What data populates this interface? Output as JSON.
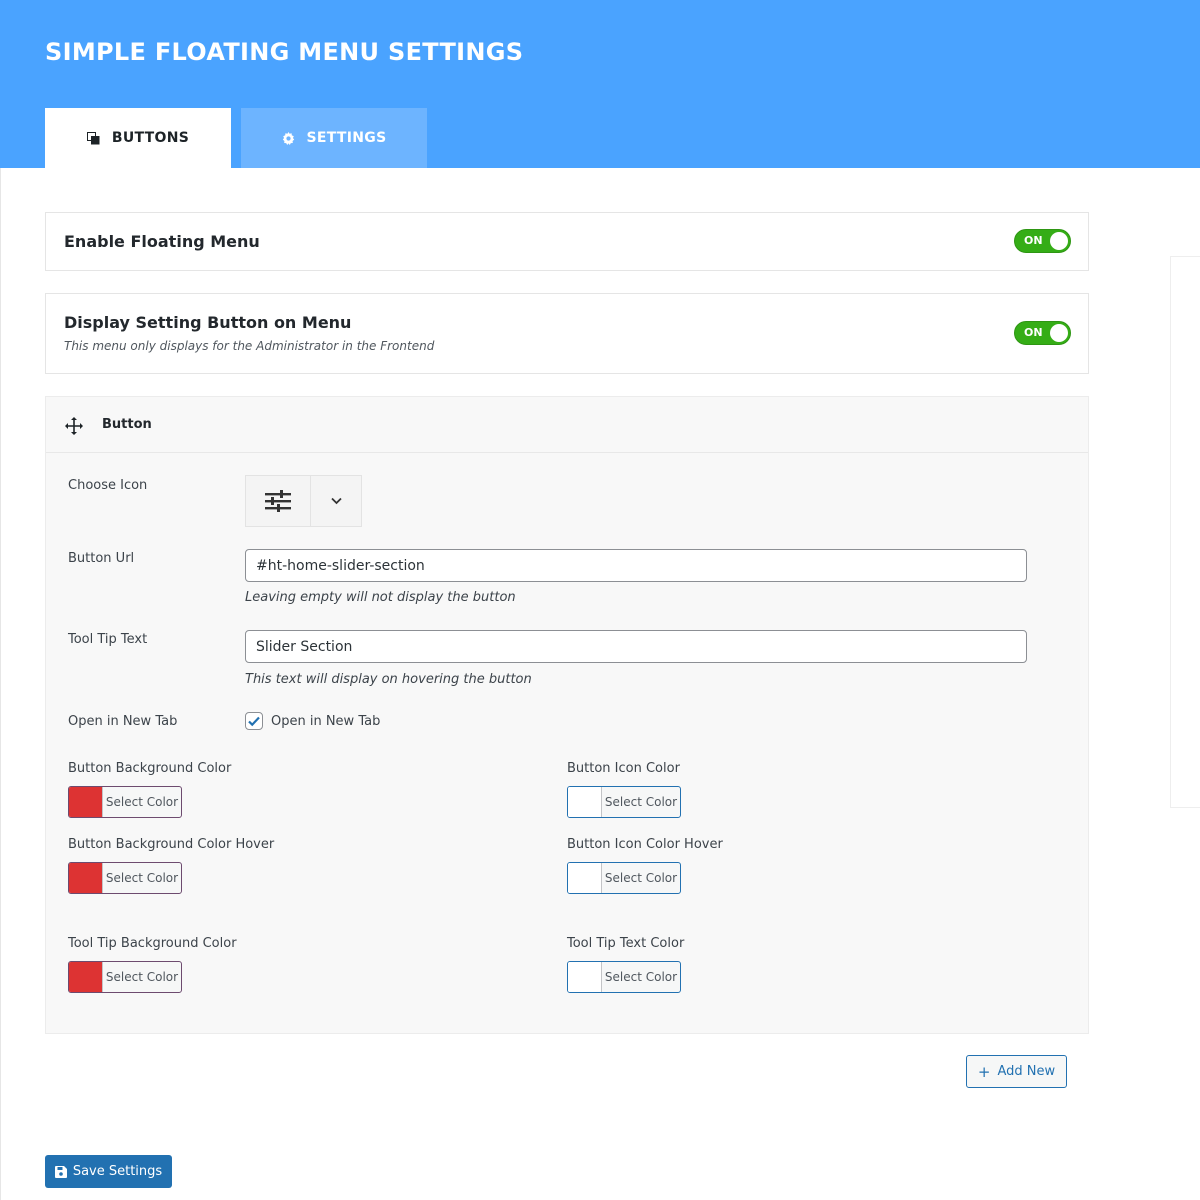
{
  "header": {
    "title": "SIMPLE FLOATING MENU SETTINGS"
  },
  "tabs": [
    {
      "label": "BUTTONS",
      "icon": "copy-icon",
      "active": true
    },
    {
      "label": "SETTINGS",
      "icon": "gear-icon",
      "active": false
    }
  ],
  "enable_menu": {
    "title": "Enable Floating Menu",
    "toggle": "ON"
  },
  "display_setting": {
    "title": "Display Setting Button on Menu",
    "subtitle": "This menu only displays for the Administrator in the Frontend",
    "toggle": "ON"
  },
  "button_panel": {
    "title": "Button",
    "choose_icon_label": "Choose Icon",
    "selected_icon": "sliders-icon",
    "url_label": "Button Url",
    "url_value": "#ht-home-slider-section",
    "url_hint": "Leaving empty will not display the button",
    "tooltip_label": "Tool Tip Text",
    "tooltip_value": "Slider Section",
    "tooltip_hint": "This text will display on hovering the button",
    "new_tab_label": "Open in New Tab",
    "new_tab_checkbox_label": "Open in New Tab",
    "new_tab_checked": true,
    "colors": {
      "bg_label": "Button Background Color",
      "bg_value": "#dd3333",
      "icon_label": "Button Icon Color",
      "icon_value": "#ffffff",
      "bg_hover_label": "Button Background Color Hover",
      "bg_hover_value": "#dd3333",
      "icon_hover_label": "Button Icon Color Hover",
      "icon_hover_value": "#ffffff",
      "tooltip_bg_label": "Tool Tip Background Color",
      "tooltip_bg_value": "#dd3333",
      "tooltip_text_label": "Tool Tip Text Color",
      "tooltip_text_value": "#ffffff",
      "select_label": "Select Color"
    }
  },
  "actions": {
    "add_new": "Add New",
    "save": "Save Settings"
  },
  "theme": {
    "header_bg": "#4aa3ff",
    "toggle_on": "#35ad16",
    "primary": "#2271b1"
  }
}
